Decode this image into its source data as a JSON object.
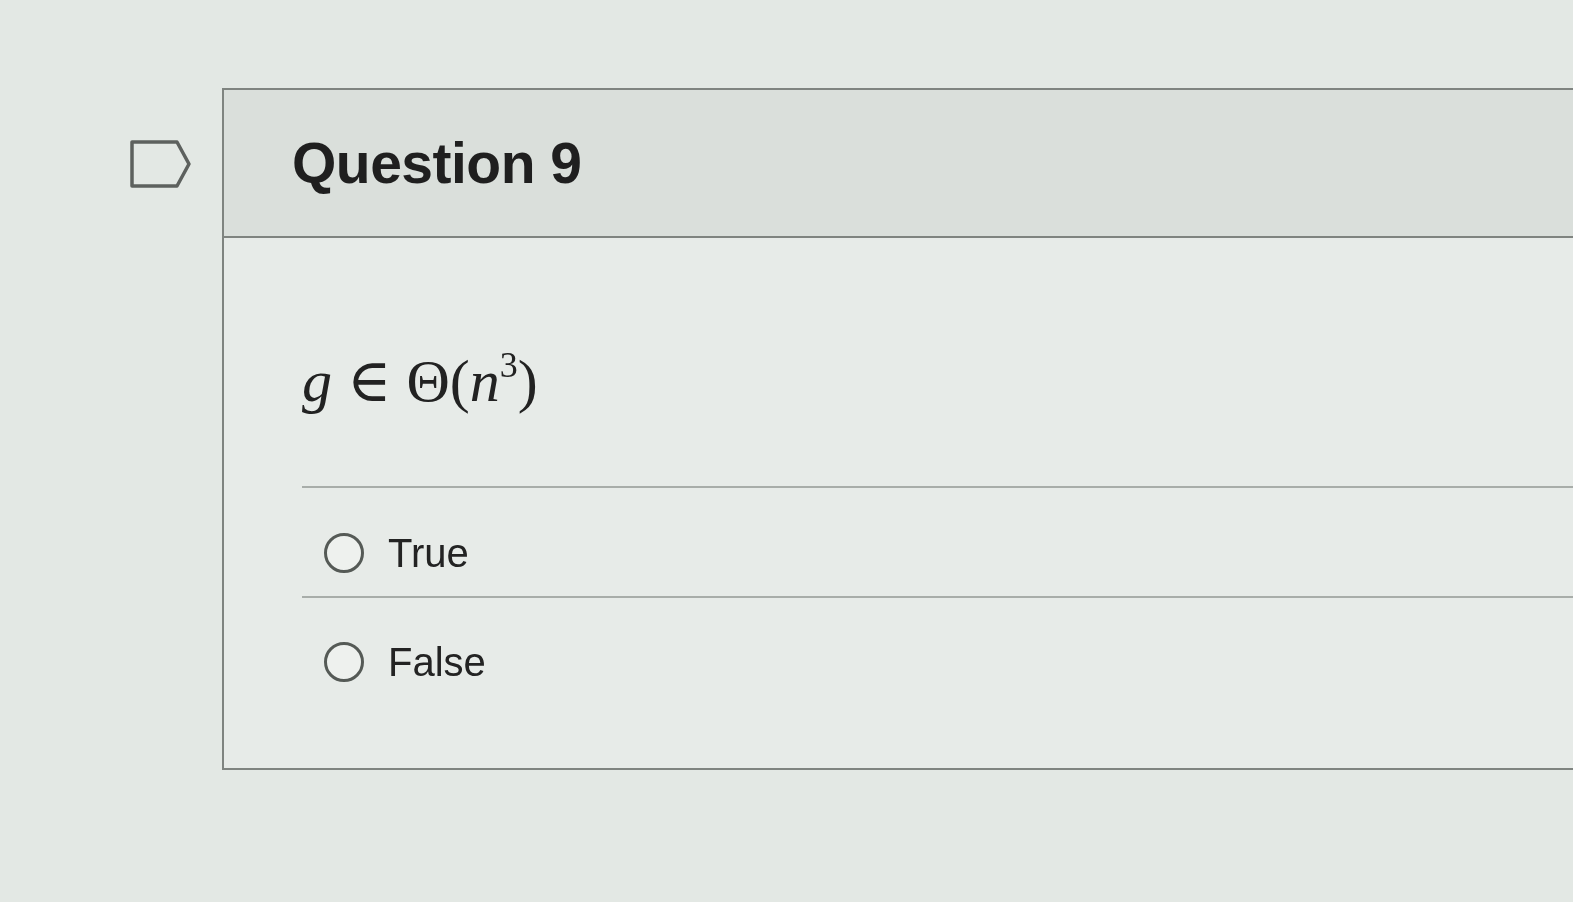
{
  "question": {
    "flagged": false,
    "title": "Question 9",
    "prompt": "*g* ∈ Θ(*n*$^{3}$)",
    "options": [
      {
        "label": "True",
        "selected": false
      },
      {
        "label": "False",
        "selected": false
      }
    ]
  }
}
